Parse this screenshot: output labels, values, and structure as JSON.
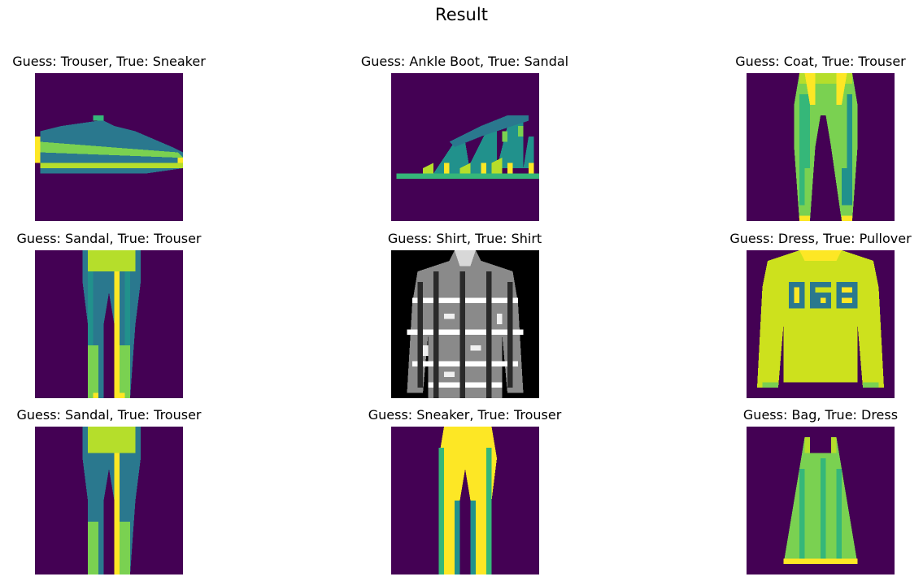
{
  "title": "Result",
  "chart_data": {
    "type": "image-grid",
    "grid": [
      3,
      3
    ],
    "image_resolution": [
      28,
      28
    ],
    "colormaps": [
      "viridis",
      "gray"
    ],
    "axes": "off",
    "panels": [
      {
        "guess": "Trouser",
        "true": "Sneaker",
        "label": "Guess: Trouser, True: Sneaker",
        "depicts": "sneaker",
        "colormap": "viridis"
      },
      {
        "guess": "Ankle Boot",
        "true": "Sandal",
        "label": "Guess: Ankle Boot, True: Sandal",
        "depicts": "sandal",
        "colormap": "viridis"
      },
      {
        "guess": "Coat",
        "true": "Trouser",
        "label": "Guess: Coat, True: Trouser",
        "depicts": "trouser",
        "colormap": "viridis"
      },
      {
        "guess": "Sandal",
        "true": "Trouser",
        "label": "Guess: Sandal, True: Trouser",
        "depicts": "trouser",
        "colormap": "viridis"
      },
      {
        "guess": "Shirt",
        "true": "Shirt",
        "label": "Guess: Shirt, True: Shirt",
        "depicts": "plaid shirt",
        "colormap": "gray"
      },
      {
        "guess": "Dress",
        "true": "Pullover",
        "label": "Guess: Dress, True: Pullover",
        "depicts": "pullover",
        "colormap": "viridis"
      },
      {
        "guess": "Sandal",
        "true": "Trouser",
        "label": "Guess: Sandal, True: Trouser",
        "depicts": "trouser",
        "colormap": "viridis"
      },
      {
        "guess": "Sneaker",
        "true": "Trouser",
        "label": "Guess: Sneaker, True: Trouser",
        "depicts": "trouser",
        "colormap": "viridis"
      },
      {
        "guess": "Bag",
        "true": "Dress",
        "label": "Guess: Bag, True: Dress",
        "depicts": "dress",
        "colormap": "viridis"
      }
    ]
  }
}
